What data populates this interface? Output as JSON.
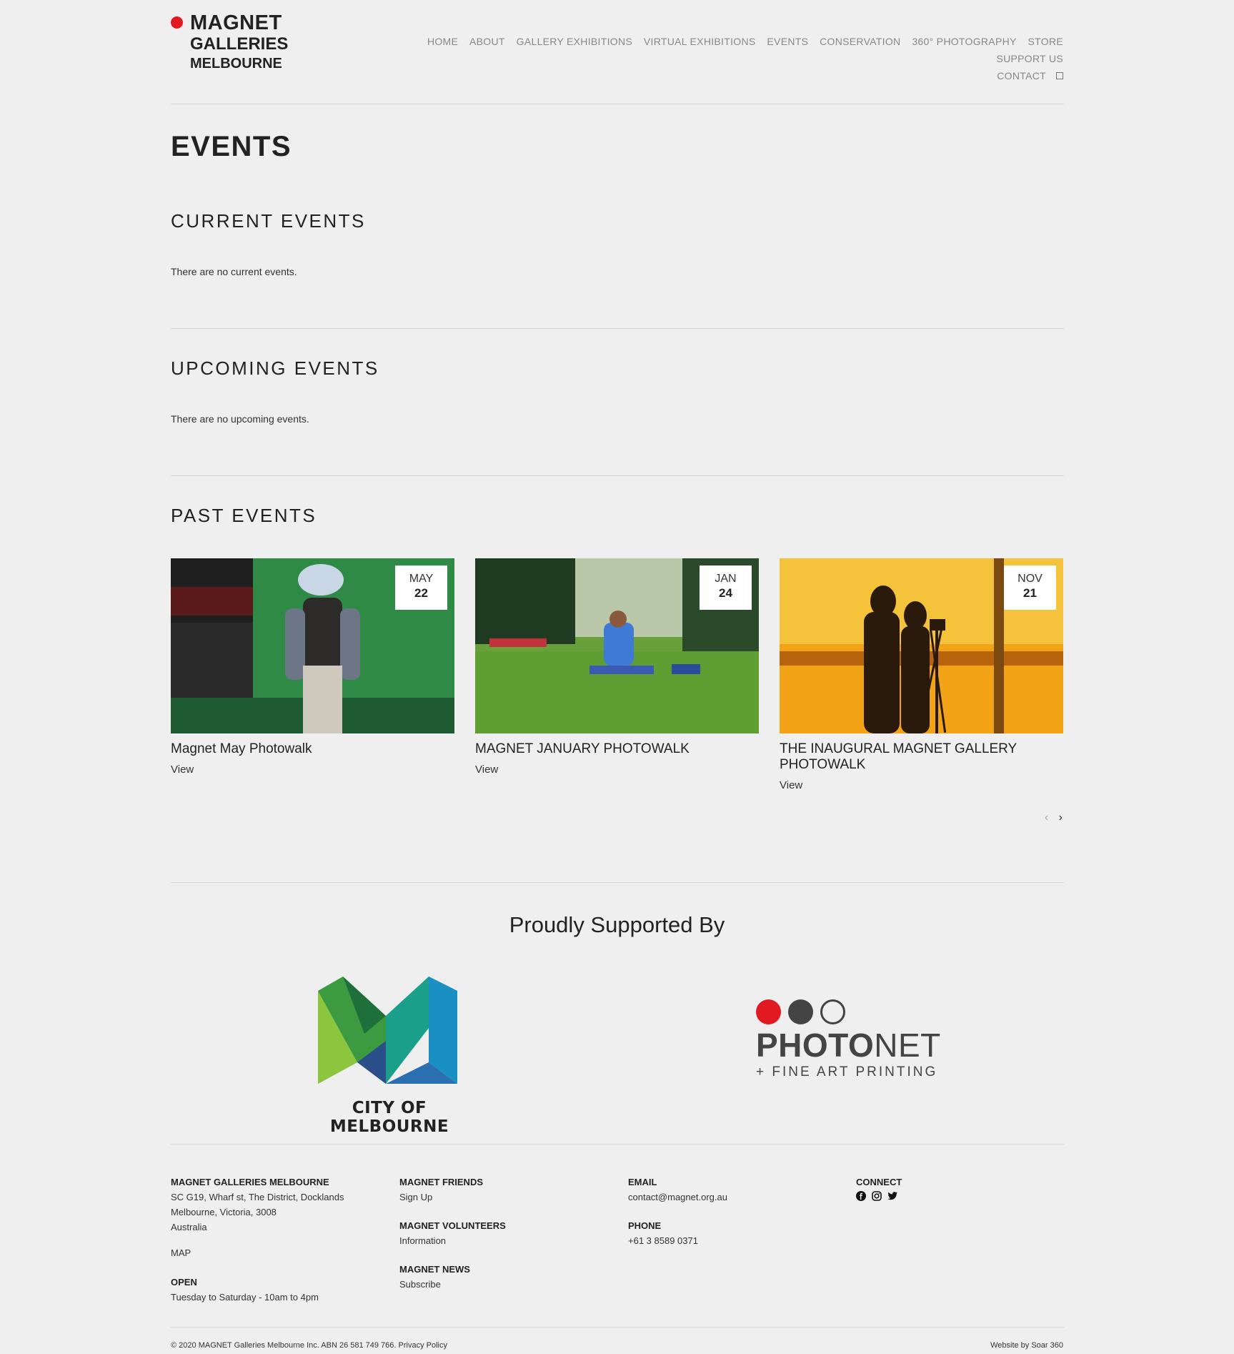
{
  "logo": {
    "line1": "MAGNET",
    "line2": "GALLERIES",
    "line3": "MELBOURNE",
    "dot_color": "#e11a22"
  },
  "nav": {
    "items": [
      "HOME",
      "ABOUT",
      "GALLERY EXHIBITIONS",
      "VIRTUAL EXHIBITIONS",
      "EVENTS",
      "CONSERVATION",
      "360° PHOTOGRAPHY",
      "STORE",
      "SUPPORT US"
    ],
    "row2": "CONTACT"
  },
  "page_title": "EVENTS",
  "current": {
    "heading": "CURRENT EVENTS",
    "message": "There are no current events."
  },
  "upcoming": {
    "heading": "UPCOMING EVENTS",
    "message": "There are no upcoming events."
  },
  "past": {
    "heading": "PAST EVENTS",
    "events": [
      {
        "month": "MAY",
        "day": "22",
        "title": "Magnet May Photowalk",
        "link": "View"
      },
      {
        "month": "JAN",
        "day": "24",
        "title": "MAGNET JANUARY PHOTOWALK",
        "link": "View"
      },
      {
        "month": "NOV",
        "day": "21",
        "title": "THE INAUGURAL MAGNET GALLERY PHOTOWALK",
        "link": "View"
      }
    ],
    "prev": "‹",
    "next": "›"
  },
  "supported": {
    "heading": "Proudly Supported By",
    "sponsor1": "CITY OF MELBOURNE",
    "sponsor2_bold": "PHOTO",
    "sponsor2_light": "NET",
    "sponsor2_sub": "+ FINE ART PRINTING"
  },
  "footer": {
    "col1": {
      "heading": "MAGNET GALLERIES MELBOURNE",
      "address1": "SC G19, Wharf st, The District, Docklands",
      "address2": "Melbourne, Victoria, 3008",
      "address3": "Australia",
      "map": "MAP",
      "open_heading": "OPEN",
      "open_text": "Tuesday to Saturday - 10am to 4pm"
    },
    "col2": {
      "friends_heading": "MAGNET FRIENDS",
      "friends_link": "Sign Up",
      "volunteers_heading": "MAGNET VOLUNTEERS",
      "volunteers_link": "Information",
      "news_heading": "MAGNET NEWS",
      "news_link": "Subscribe"
    },
    "col3": {
      "email_heading": "EMAIL",
      "email": "contact@magnet.org.au",
      "phone_heading": "PHONE",
      "phone": "+61 3 8589 0371"
    },
    "col4": {
      "connect_heading": "CONNECT"
    },
    "copyright": "© 2020 MAGNET Galleries Melbourne Inc. ABN 26 581 749 766.",
    "privacy": "Privacy Policy",
    "credit": "Website by Soar 360"
  }
}
